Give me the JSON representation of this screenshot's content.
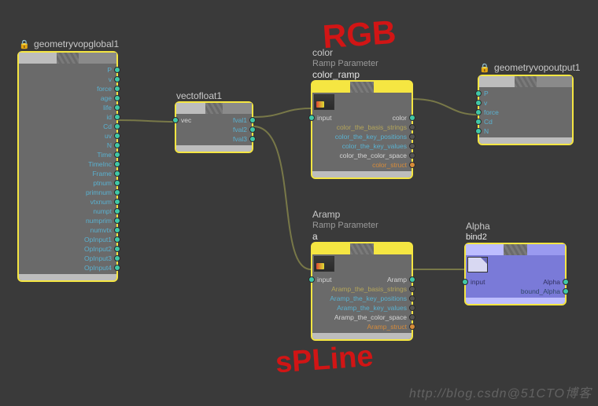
{
  "annotations": {
    "rgb": "RGB",
    "spline": "sPLine"
  },
  "watermark": "http://blog.csdn@51CTO博客",
  "nodes": {
    "geomglobal": {
      "title": "geometryvopglobal1",
      "locked": true,
      "outputs": [
        "P",
        "v",
        "force",
        "age",
        "life",
        "id",
        "Cd",
        "uv",
        "N",
        "Time",
        "TimeInc",
        "Frame",
        "ptnum",
        "primnum",
        "vtxnum",
        "numpt",
        "numprim",
        "numvtx",
        "OpInput1",
        "OpInput2",
        "OpInput3",
        "OpInput4"
      ]
    },
    "vectofloat": {
      "title": "vectofloat1",
      "in_label": "vec",
      "outputs": [
        "fval1",
        "fval2",
        "fval3"
      ]
    },
    "colorramp": {
      "title": "color",
      "subtitle": "Ramp Parameter",
      "name": "color_ramp",
      "in_label": "input",
      "outputs": [
        "color",
        "color_the_basis_strings",
        "color_the_key_positions",
        "color_the_key_values",
        "color_the_color_space",
        "color_struct"
      ]
    },
    "aramp": {
      "title": "Aramp",
      "subtitle": "Ramp Parameter",
      "name": "a",
      "in_label": "input",
      "outputs": [
        "Aramp",
        "Aramp_the_basis_strings",
        "Aramp_the_key_positions",
        "Aramp_the_key_values",
        "Aramp_the_color_space",
        "Aramp_struct"
      ]
    },
    "geomout": {
      "title": "geometryvopoutput1",
      "locked": true,
      "inputs": [
        "P",
        "v",
        "force",
        "Cd",
        "N"
      ]
    },
    "bind": {
      "title": "Alpha",
      "name": "bind2",
      "in_label": "input",
      "out1": "Alpha",
      "out2": "bound_Alpha"
    }
  }
}
